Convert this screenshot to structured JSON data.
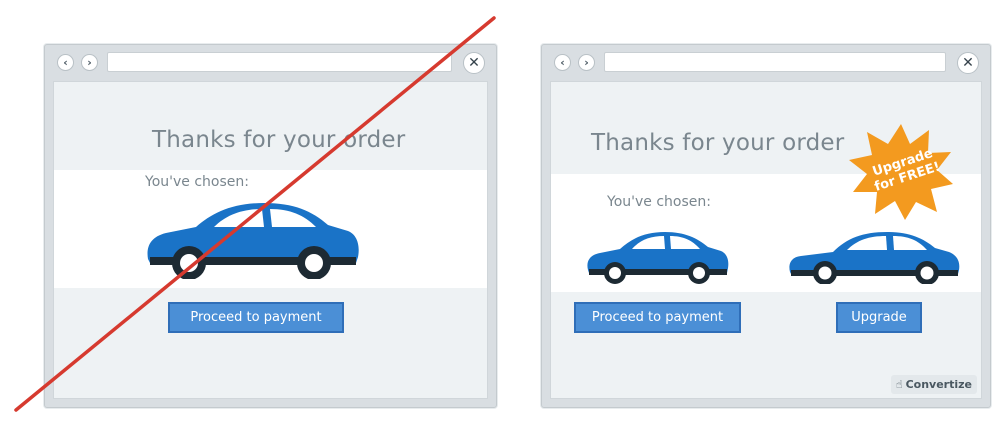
{
  "left_panel": {
    "nav_back": "‹",
    "nav_forward": "›",
    "close": "✕",
    "headline": "Thanks for your order",
    "chosen_label": "You've chosen:",
    "proceed_label": "Proceed to payment"
  },
  "right_panel": {
    "nav_back": "‹",
    "nav_forward": "›",
    "close": "✕",
    "headline": "Thanks for your order",
    "chosen_label": "You've chosen:",
    "proceed_label": "Proceed to payment",
    "upgrade_label": "Upgrade",
    "burst_line1": "Upgrade",
    "burst_line2": "for FREE!",
    "brand": "Convertize",
    "brand_icon": "hand-pointer-icon"
  },
  "colors": {
    "car_blue": "#1a73c7",
    "button_blue": "#4b8fd6",
    "burst_orange": "#f39a1f",
    "strike_red": "#d63a2f"
  }
}
